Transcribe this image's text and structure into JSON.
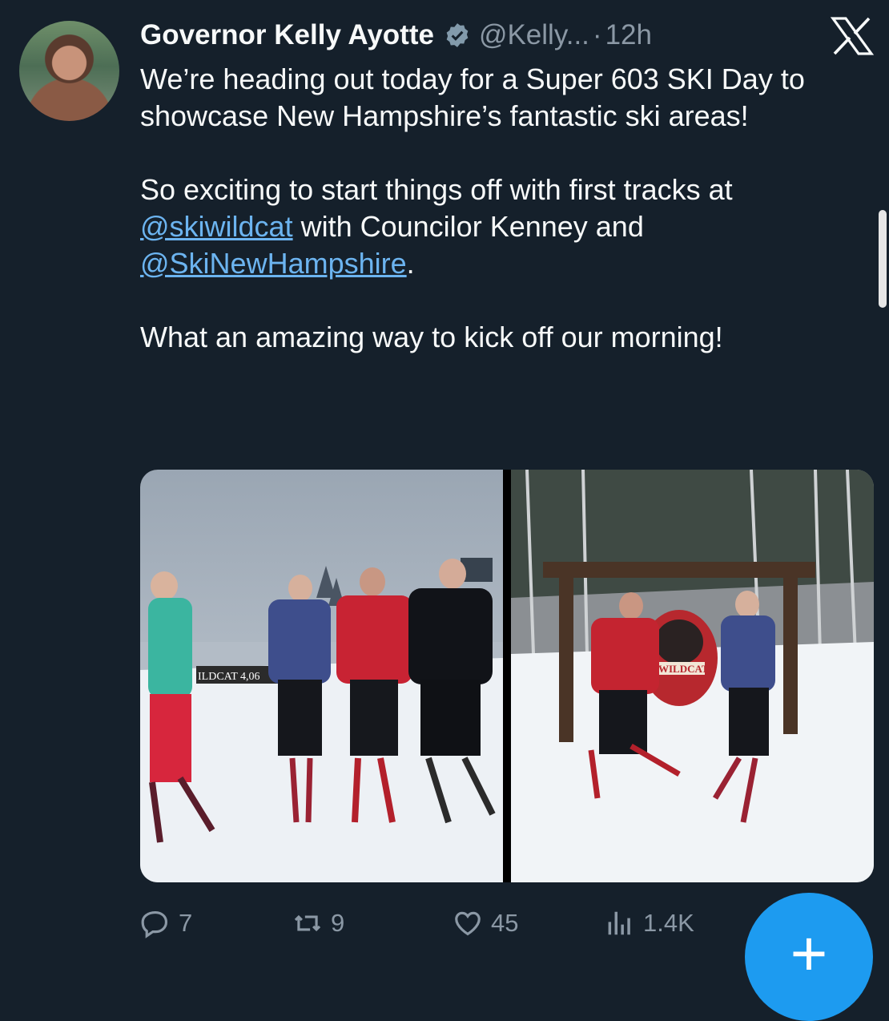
{
  "author": {
    "name": "Governor Kelly Ayotte",
    "handle": "@Kelly...",
    "separator": "·",
    "time": "12h"
  },
  "tweet": {
    "line1": "We’re heading out today for a Super 603 SKI Day to showcase New Hampshire’s fantastic ski areas!",
    "para2_text1": "So exciting to start things off with first tracks at ",
    "mention1": "@skiwildcat",
    "para2_text2": " with Councilor Kenney and ",
    "mention2": "@SkiNewHampshire",
    "para2_text3": ".",
    "para3": "What an amazing way to kick off our morning!"
  },
  "media": {
    "photo1_sign": "ILDCAT 4,06",
    "photo2_sign": "WILDCAT"
  },
  "actions": {
    "replies": "7",
    "reposts": "9",
    "likes": "45",
    "views": "1.4K"
  },
  "fab": {
    "label": "+"
  },
  "colors": {
    "background": "#15202b",
    "text": "#f7f9f9",
    "muted": "#8b98a5",
    "link": "#6cb4f0",
    "accent": "#1d9bf0"
  },
  "icons": [
    "x-logo-icon",
    "verified-badge-icon",
    "reply-icon",
    "repost-icon",
    "like-icon",
    "views-icon",
    "plus-icon"
  ]
}
